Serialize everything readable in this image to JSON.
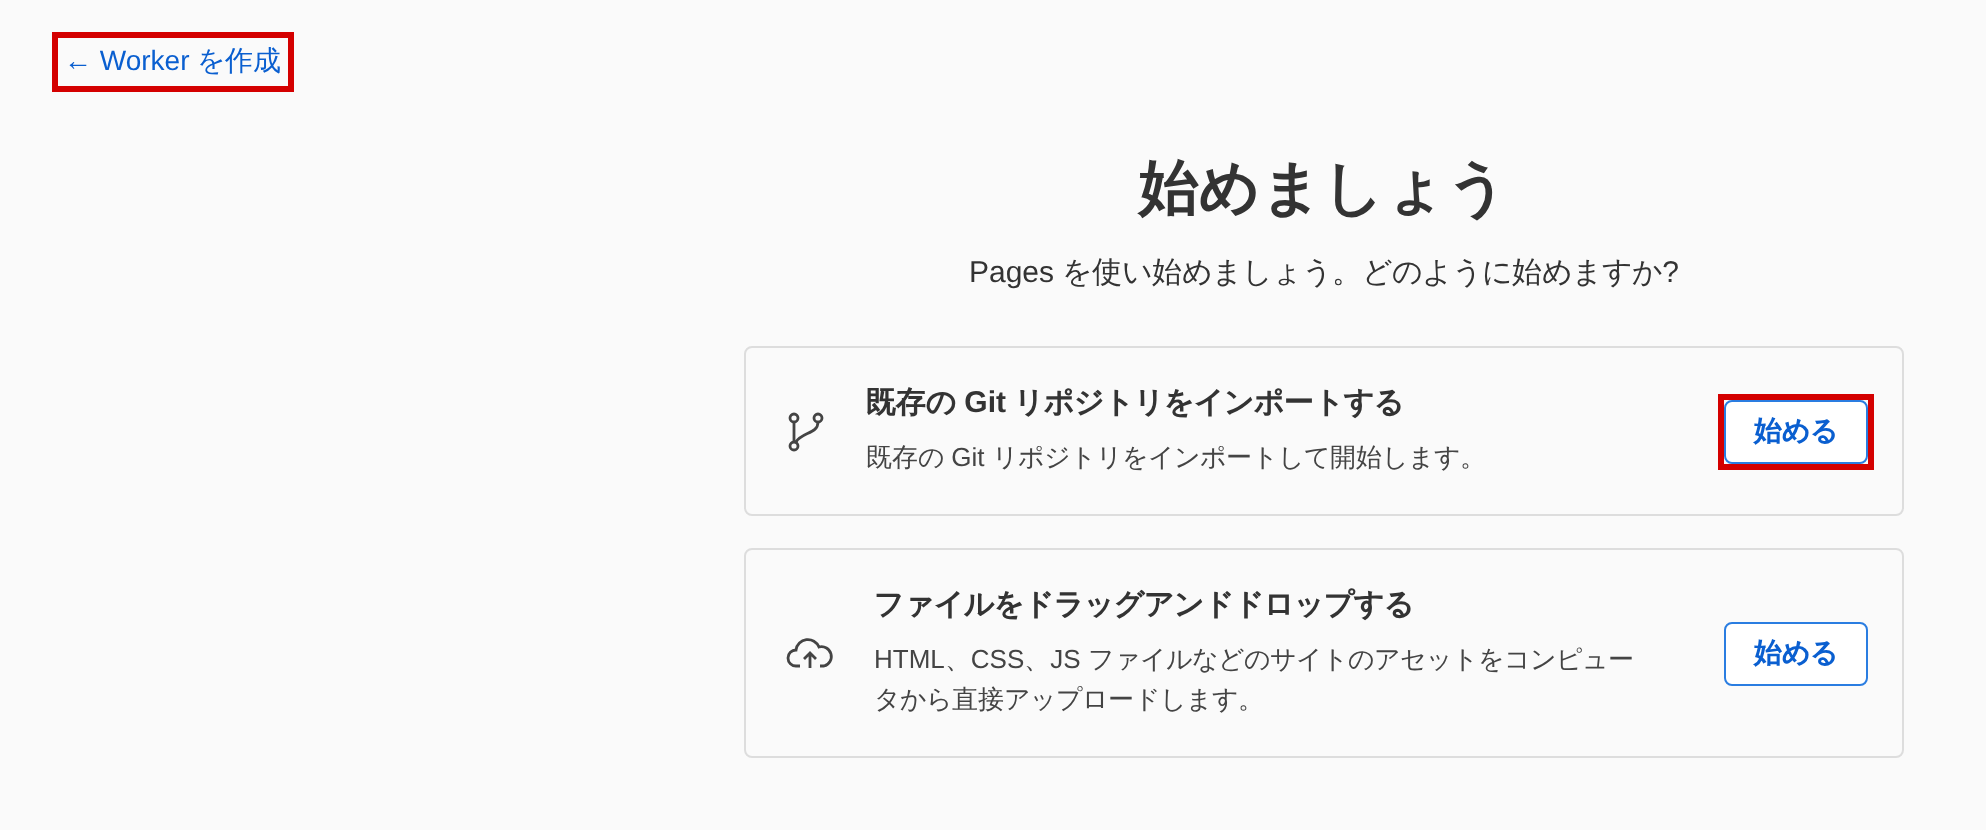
{
  "back_link": {
    "arrow": "←",
    "label": "Worker を作成",
    "highlighted": true
  },
  "heading": {
    "title": "始めましょう",
    "subtitle": "Pages を使い始めましょう。どのように始めますか?"
  },
  "options": [
    {
      "kind": "git",
      "title": "既存の Git リポジトリをインポートする",
      "description": "既存の Git リポジトリをインポートして開始します。",
      "button": "始める",
      "highlighted": true
    },
    {
      "kind": "upload",
      "title": "ファイルをドラッグアンドドロップする",
      "description": "HTML、CSS、JS ファイルなどのサイトのアセットをコンピュータから直接アップロードします。",
      "button": "始める",
      "highlighted": false
    }
  ]
}
